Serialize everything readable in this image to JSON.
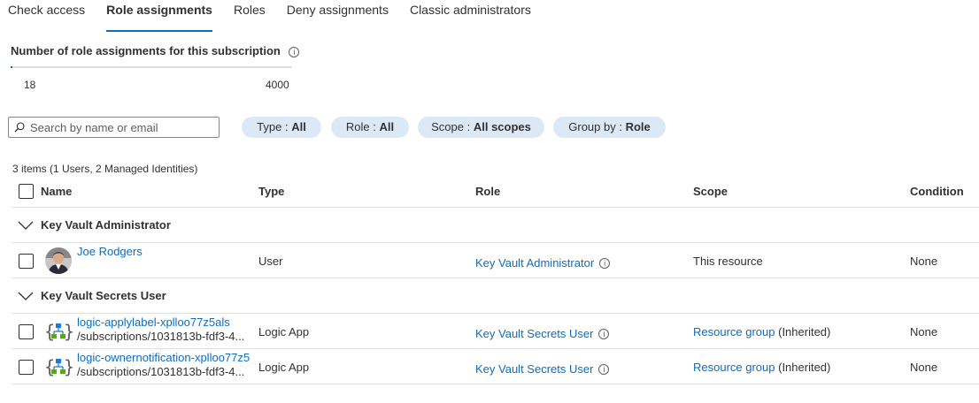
{
  "tabs": [
    {
      "label": "Check access"
    },
    {
      "label": "Role assignments"
    },
    {
      "label": "Roles"
    },
    {
      "label": "Deny assignments"
    },
    {
      "label": "Classic administrators"
    }
  ],
  "active_tab": "Role assignments",
  "count_card": {
    "title": "Number of role assignments for this subscription",
    "info_icon": "info-icon",
    "current": "18",
    "max": "4000",
    "progress_fraction": 0.0045
  },
  "search": {
    "placeholder": "Search by name or email",
    "value": "",
    "icon": "search-icon"
  },
  "filters": [
    {
      "key": "Type",
      "sep": " : ",
      "value": "All"
    },
    {
      "key": "Role",
      "sep": " : ",
      "value": "All"
    },
    {
      "key": "Scope",
      "sep": " : ",
      "value": "All scopes"
    },
    {
      "key": "Group by",
      "sep": " : ",
      "value": "Role"
    }
  ],
  "items_summary": "3 items (1 Users, 2 Managed Identities)",
  "columns": [
    "Name",
    "Type",
    "Role",
    "Scope",
    "Condition"
  ],
  "groups": [
    {
      "name": "Key Vault Administrator",
      "rows": [
        {
          "name": "Joe Rodgers",
          "subtitle": "",
          "icon": "user-avatar",
          "type": "User",
          "role": "Key Vault Administrator",
          "scope_link": "",
          "scope_text": "This resource",
          "condition": "None"
        }
      ]
    },
    {
      "name": "Key Vault Secrets User",
      "rows": [
        {
          "name": "logic-applylabel-xplloo77z5als",
          "subtitle": "/subscriptions/1031813b-fdf3-4...",
          "icon": "logic-app-icon",
          "type": "Logic App",
          "role": "Key Vault Secrets User",
          "scope_link": "Resource group",
          "scope_text": " (Inherited)",
          "condition": "None"
        },
        {
          "name": "logic-ownernotification-xplloo77z5",
          "subtitle": "/subscriptions/1031813b-fdf3-4...",
          "icon": "logic-app-icon",
          "type": "Logic App",
          "role": "Key Vault Secrets User",
          "scope_link": "Resource group",
          "scope_text": " (Inherited)",
          "condition": "None"
        }
      ]
    }
  ],
  "colors": {
    "accent": "#0f6cbd",
    "pill_bg": "#dbe9f7",
    "divider": "#e1dfdd"
  }
}
